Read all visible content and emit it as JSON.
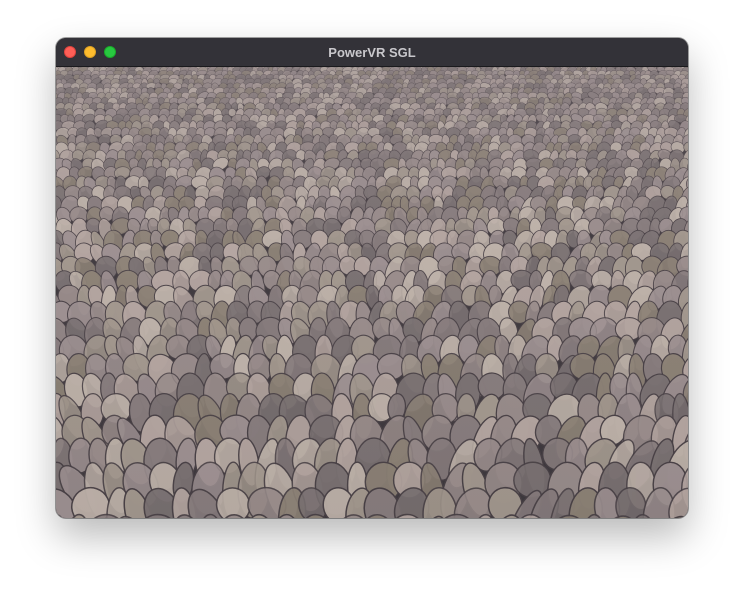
{
  "window": {
    "title": "PowerVR SGL",
    "controls": {
      "close_color": "#fe5f57",
      "minimize_color": "#febc2e",
      "maximize_color": "#28c840"
    }
  },
  "scene": {
    "content": "cobblestone-floor",
    "palette": [
      "#8a7f80",
      "#a09394",
      "#b8a9a4",
      "#9c8f8e",
      "#7d7475",
      "#c2b6ad",
      "#8f8478",
      "#a69b91"
    ]
  }
}
